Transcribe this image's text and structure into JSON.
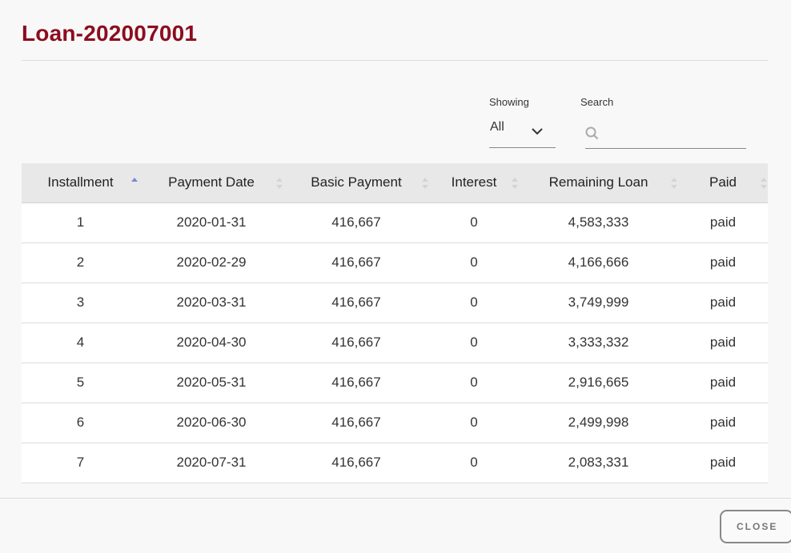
{
  "modal": {
    "title": "Loan-202007001",
    "close_label": "CLOSE"
  },
  "filters": {
    "showing_label": "Showing",
    "showing_value": "All",
    "search_label": "Search",
    "search_value": ""
  },
  "table": {
    "columns": [
      {
        "label": "Installment",
        "sort": "asc",
        "sort_color": "#7b86d6"
      },
      {
        "label": "Payment Date",
        "sort": "none"
      },
      {
        "label": "Basic Payment",
        "sort": "none"
      },
      {
        "label": "Interest",
        "sort": "none"
      },
      {
        "label": "Remaining Loan",
        "sort": "none"
      },
      {
        "label": "Paid",
        "sort": "none"
      }
    ],
    "rows": [
      [
        "1",
        "2020-01-31",
        "416,667",
        "0",
        "4,583,333",
        "paid"
      ],
      [
        "2",
        "2020-02-29",
        "416,667",
        "0",
        "4,166,666",
        "paid"
      ],
      [
        "3",
        "2020-03-31",
        "416,667",
        "0",
        "3,749,999",
        "paid"
      ],
      [
        "4",
        "2020-04-30",
        "416,667",
        "0",
        "3,333,332",
        "paid"
      ],
      [
        "5",
        "2020-05-31",
        "416,667",
        "0",
        "2,916,665",
        "paid"
      ],
      [
        "6",
        "2020-06-30",
        "416,667",
        "0",
        "2,499,998",
        "paid"
      ],
      [
        "7",
        "2020-07-31",
        "416,667",
        "0",
        "2,083,331",
        "paid"
      ]
    ]
  },
  "colors": {
    "title": "#8b0d1e",
    "header_bg": "#e8e8e8",
    "sort_active": "#7b86d6",
    "sort_inactive": "#d4d4d4"
  }
}
